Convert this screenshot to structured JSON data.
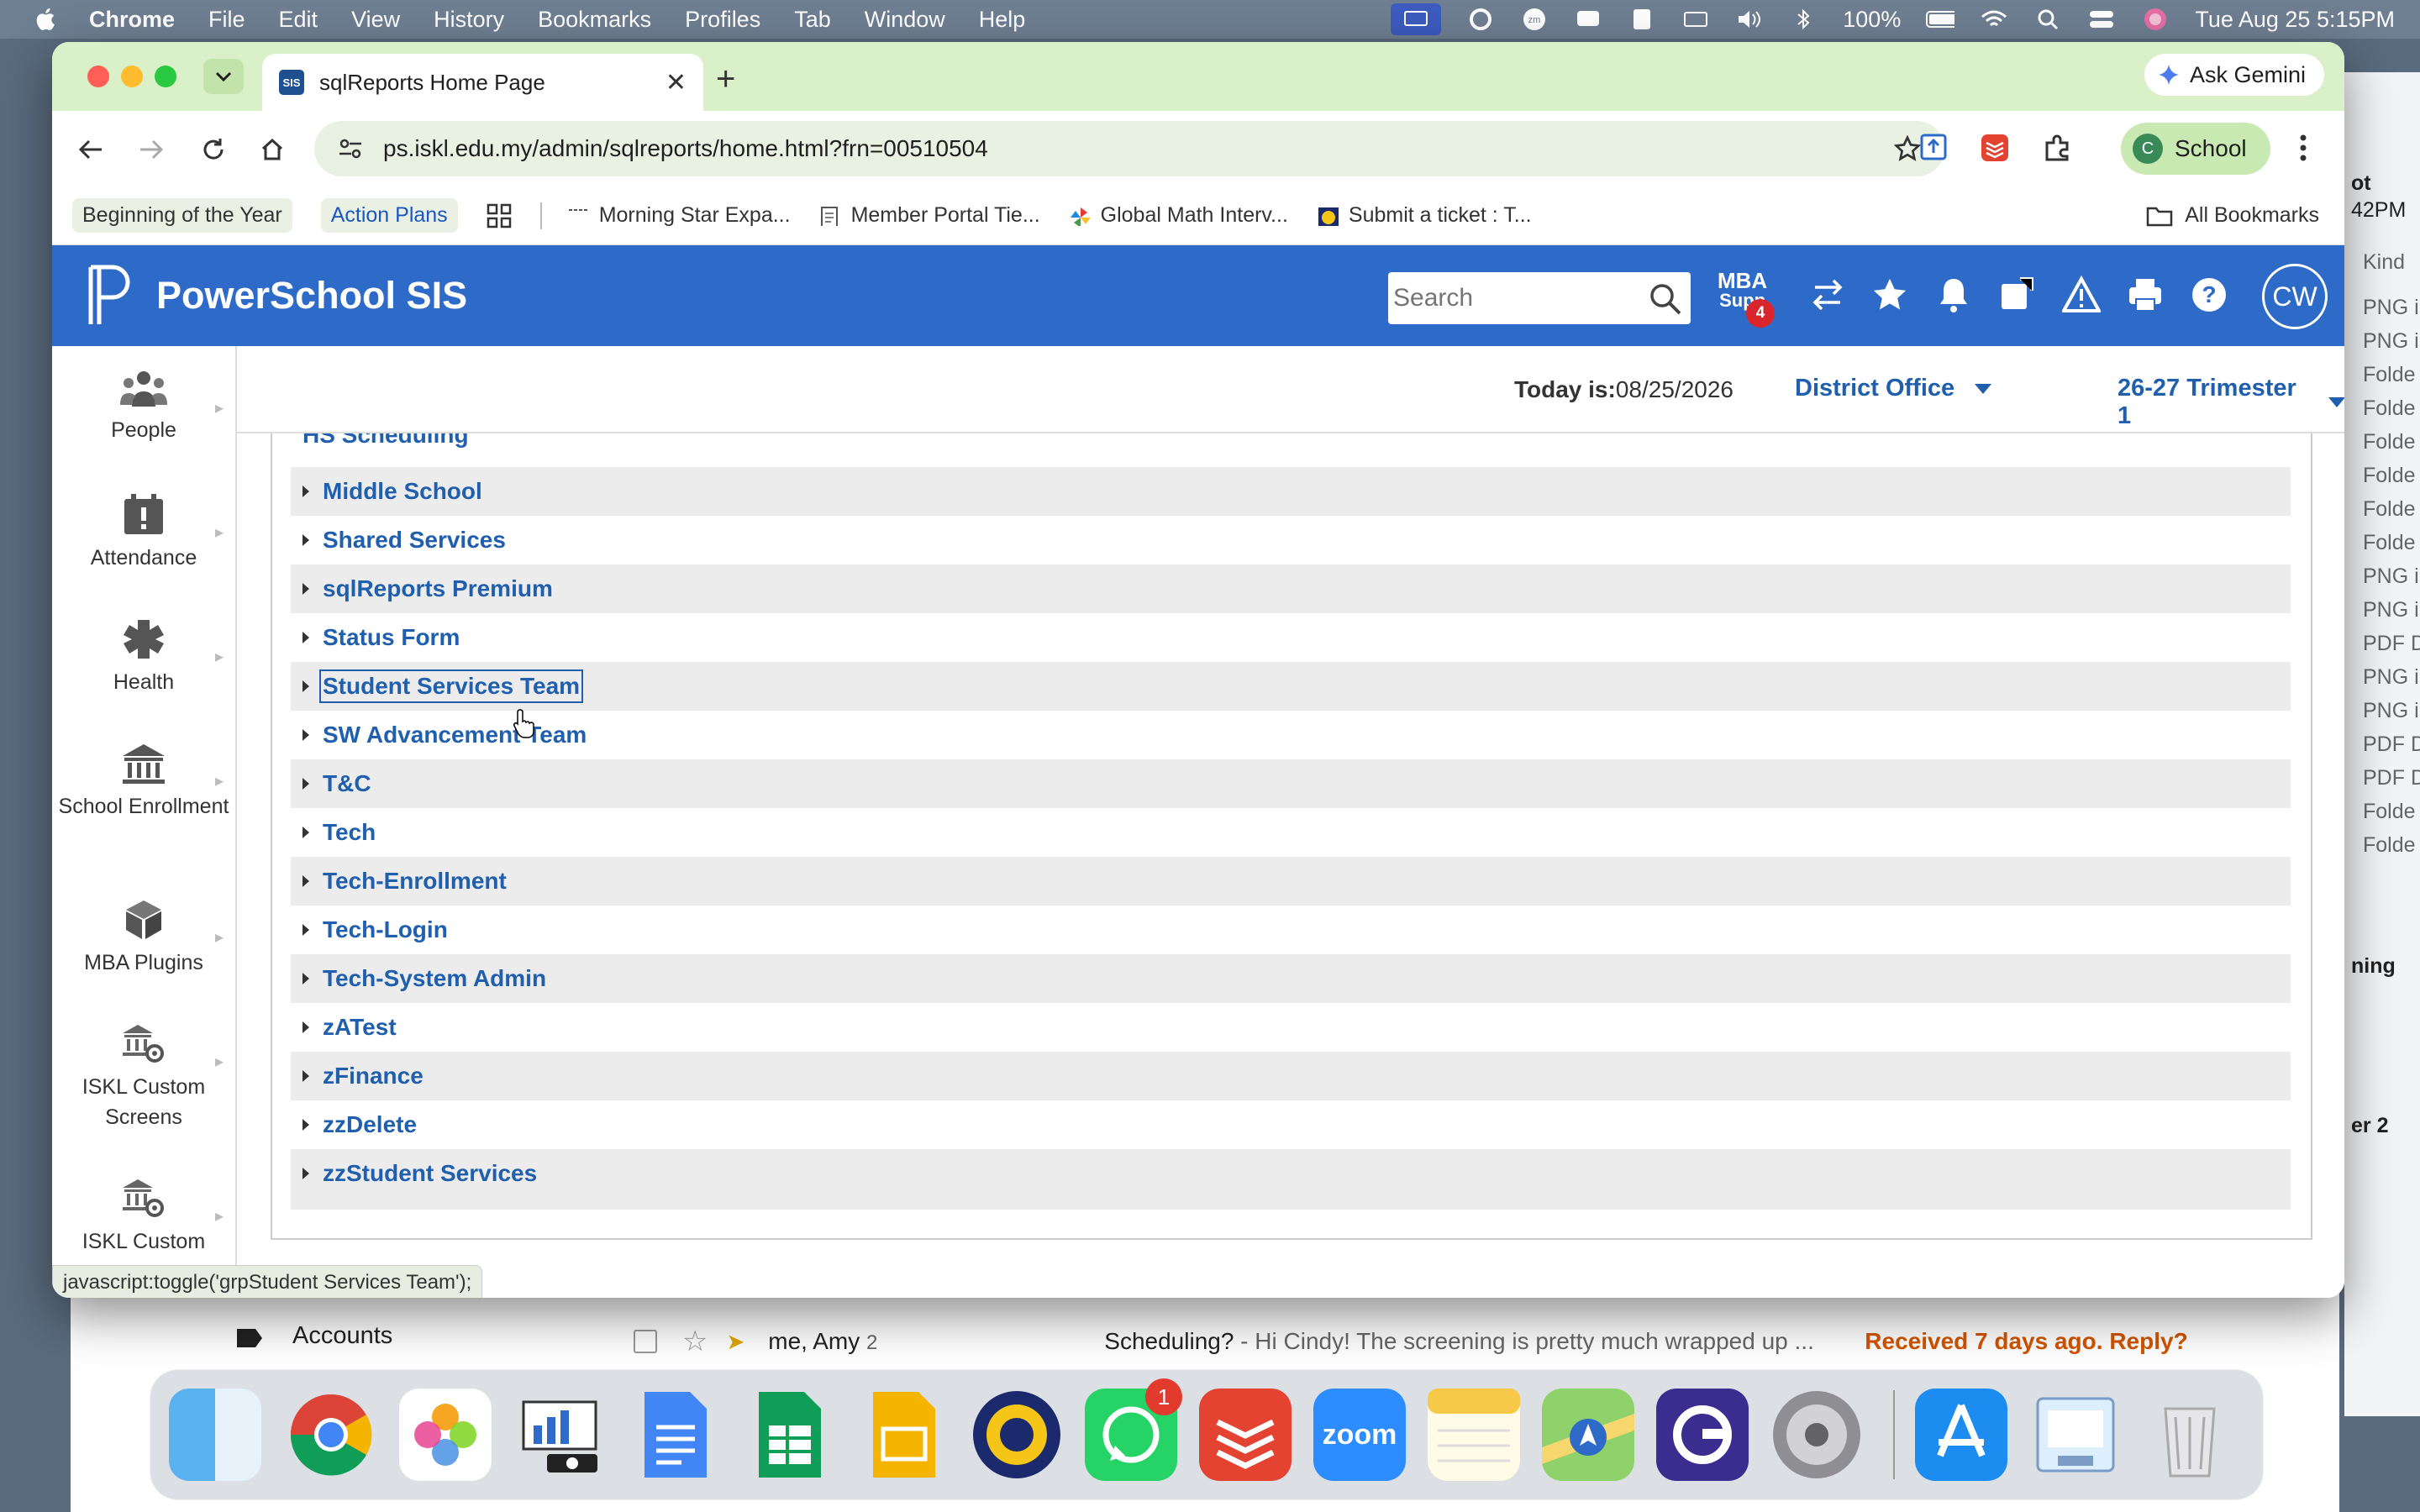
{
  "menubar": {
    "app": "Chrome",
    "items": [
      "File",
      "Edit",
      "View",
      "History",
      "Bookmarks",
      "Profiles",
      "Tab",
      "Window",
      "Help"
    ],
    "battery": "100%",
    "datetime": "Tue Aug 25  5:15PM"
  },
  "browser": {
    "tab_title": "sqlReports Home Page",
    "tab_favicon": "SIS",
    "ask_gemini": "Ask Gemini",
    "url": "ps.iskl.edu.my/admin/sqlreports/home.html?frn=00510504",
    "profile_initial": "C",
    "profile_name": "School",
    "bookmarks": [
      "Beginning of the Year",
      "Action Plans",
      "Morning Star Expa...",
      "Member Portal Tie...",
      "Global Math Interv...",
      "Submit a ticket : T..."
    ],
    "all_bookmarks": "All Bookmarks",
    "status_url": "javascript:toggle('grpStudent Services Team');"
  },
  "ps": {
    "brand": "PowerSchool SIS",
    "search_placeholder": "Search",
    "mba_label_1": "MBA",
    "mba_label_2": "Supp",
    "mba_badge": "4",
    "user_initials": "CW",
    "today_label": "Today is:",
    "today_date": "08/25/2026",
    "school": "District Office",
    "term": "26-27 Trimester 1",
    "sidebar": [
      {
        "label": "People",
        "icon": "people-icon"
      },
      {
        "label": "Attendance",
        "icon": "attendance-icon"
      },
      {
        "label": "Health",
        "icon": "health-icon"
      },
      {
        "label": "School Enrollment",
        "icon": "school-icon"
      },
      {
        "label": "MBA Plugins",
        "icon": "plugin-cube-icon"
      },
      {
        "label": "ISKL Custom Screens",
        "icon": "custom-screens-icon"
      },
      {
        "label": "ISKL Custom",
        "icon": "custom-screens-icon"
      }
    ],
    "partial_group": "HS Scheduling",
    "groups": [
      "Middle School",
      "Shared Services",
      "sqlReports Premium",
      "Status Form",
      "Student Services Team",
      "SW Advancement Team",
      "T&C",
      "Tech",
      "Tech-Enrollment",
      "Tech-Login",
      "Tech-System Admin",
      "zATest",
      "zFinance",
      "zzDelete",
      "zzStudent Services"
    ],
    "focused_group": "Student Services Team"
  },
  "background": {
    "finder_header": "Kind",
    "finder_rows": [
      "PNG i",
      "PNG i",
      "Folde",
      "Folde",
      "Folde",
      "Folde",
      "Folde",
      "Folde",
      "PNG i",
      "PNG i",
      "PDF D",
      "PNG i",
      "PNG i",
      "PDF D",
      "PDF D",
      "Folde",
      "Folde"
    ],
    "finder_top_1": "ot",
    "finder_top_2": "42PM",
    "finder_mid": "ning",
    "finder_low": "er 2",
    "gmail_label": "Accounts",
    "mail_from": "me, Amy",
    "mail_count": "2",
    "mail_subject": "Scheduling?",
    "mail_snippet": " - Hi Cindy! The screening is pretty much wrapped up ...",
    "mail_received": "Received 7 days ago. Reply?"
  },
  "dock": {
    "apps": [
      "finder-icon",
      "chrome-icon",
      "photos-icon",
      "keynote-icon",
      "docs-icon",
      "sheets-icon",
      "slides-icon",
      "iskl-icon",
      "whatsapp-icon",
      "todoist-icon",
      "zoom-icon",
      "notes-icon",
      "maps-icon",
      "gpt-icon",
      "settings-icon",
      "appstore-icon",
      "preview-icon",
      "trash-icon"
    ],
    "whatsapp_badge": "1",
    "zoom_label": "zoom"
  }
}
